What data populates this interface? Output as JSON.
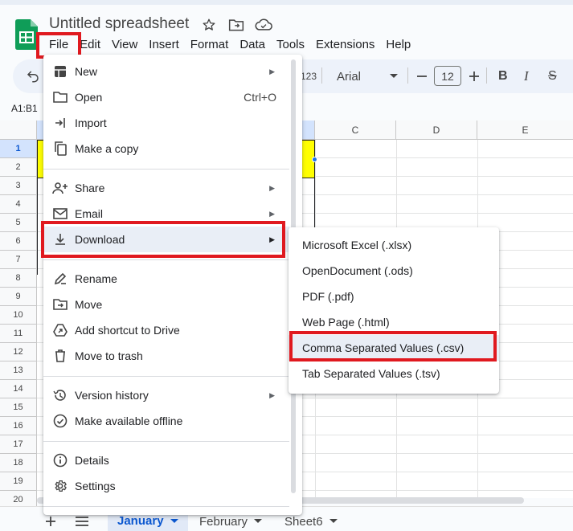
{
  "app": {
    "title": "Untitled spreadsheet",
    "colors": {
      "accent_red": "#e0191f",
      "sheets_green": "#0f9d58",
      "selection_blue": "#1a73e8",
      "yellow_fill": "#ffff00"
    }
  },
  "menubar": {
    "items": [
      {
        "label": "File"
      },
      {
        "label": "Edit"
      },
      {
        "label": "View"
      },
      {
        "label": "Insert"
      },
      {
        "label": "Format"
      },
      {
        "label": "Data"
      },
      {
        "label": "Tools"
      },
      {
        "label": "Extensions"
      },
      {
        "label": "Help"
      }
    ]
  },
  "toolbar": {
    "number_format_label": "123",
    "font_name": "Arial",
    "font_size": "12",
    "bold_label": "B",
    "italic_label": "I",
    "strike_label": "S"
  },
  "namebox": {
    "value": "A1:B1"
  },
  "grid": {
    "columns": [
      "C",
      "D",
      "E"
    ],
    "rows": [
      "1",
      "2",
      "3",
      "4",
      "5",
      "6",
      "7",
      "8",
      "9",
      "10",
      "11",
      "12",
      "13",
      "14",
      "15",
      "16",
      "17",
      "18",
      "19",
      "20"
    ]
  },
  "file_menu": {
    "items": [
      {
        "label": "New",
        "icon": "new-sheet-icon",
        "submenu": true
      },
      {
        "label": "Open",
        "icon": "folder-icon",
        "shortcut": "Ctrl+O"
      },
      {
        "label": "Import",
        "icon": "import-icon"
      },
      {
        "label": "Make a copy",
        "icon": "copy-icon"
      },
      {
        "label": "Share",
        "icon": "share-person-icon",
        "submenu": true
      },
      {
        "label": "Email",
        "icon": "email-icon",
        "submenu": true
      },
      {
        "label": "Download",
        "icon": "download-icon",
        "submenu": true
      },
      {
        "label": "Rename",
        "icon": "rename-icon"
      },
      {
        "label": "Move",
        "icon": "move-folder-icon"
      },
      {
        "label": "Add shortcut to Drive",
        "icon": "drive-shortcut-icon"
      },
      {
        "label": "Move to trash",
        "icon": "trash-icon"
      },
      {
        "label": "Version history",
        "icon": "history-icon",
        "submenu": true
      },
      {
        "label": "Make available offline",
        "icon": "offline-icon"
      },
      {
        "label": "Details",
        "icon": "info-icon"
      },
      {
        "label": "Settings",
        "icon": "gear-icon"
      }
    ]
  },
  "download_menu": {
    "items": [
      {
        "label": "Microsoft Excel (.xlsx)"
      },
      {
        "label": "OpenDocument (.ods)"
      },
      {
        "label": "PDF (.pdf)"
      },
      {
        "label": "Web Page (.html)"
      },
      {
        "label": "Comma Separated Values (.csv)"
      },
      {
        "label": "Tab Separated Values (.tsv)"
      }
    ]
  },
  "sheets": {
    "tabs": [
      {
        "label": "January",
        "active": true
      },
      {
        "label": "February"
      },
      {
        "label": "Sheet6"
      }
    ]
  }
}
